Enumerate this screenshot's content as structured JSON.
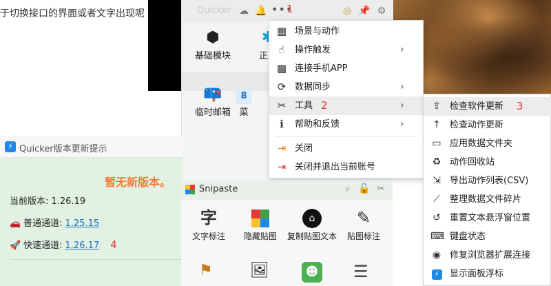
{
  "article": {
    "text": "于切换接口的界面或者文字出现呢"
  },
  "quicker": {
    "title": "Quicker",
    "more_marker": "1",
    "tiles": [
      {
        "icon": "cubes-icon",
        "label": "基础模块"
      },
      {
        "icon": "regex-icon",
        "label": "正则"
      },
      {
        "icon": "mailbox-icon",
        "label": "临时邮箱"
      },
      {
        "icon": "menu-8-icon",
        "label": "菜"
      }
    ],
    "menu": [
      {
        "icon": "grid-icon",
        "label": "场景与动作",
        "submenu": false
      },
      {
        "icon": "hand-pointer-icon",
        "label": "操作触发",
        "submenu": true
      },
      {
        "icon": "qrcode-icon",
        "label": "连接手机APP",
        "submenu": false
      },
      {
        "icon": "sync-icon",
        "label": "数据同步",
        "submenu": true
      },
      {
        "icon": "tools-icon",
        "label": "工具",
        "submenu": true,
        "marker": "2"
      },
      {
        "icon": "help-icon",
        "label": "帮助和反馈",
        "submenu": true
      },
      {
        "icon": "close-arrow-icon",
        "label": "关闭",
        "submenu": false
      },
      {
        "icon": "logout-icon",
        "label": "关闭并退出当前账号",
        "submenu": false
      }
    ],
    "submenu": [
      {
        "icon": "upload-icon",
        "label": "检查软件更新",
        "marker": "3"
      },
      {
        "icon": "arrow-up-icon",
        "label": "检查动作更新"
      },
      {
        "icon": "folder-icon",
        "label": "应用数据文件夹"
      },
      {
        "icon": "recycle-icon",
        "label": "动作回收站"
      },
      {
        "icon": "export-icon",
        "label": "导出动作列表(CSV)"
      },
      {
        "icon": "broom-icon",
        "label": "整理数据文件碎片"
      },
      {
        "icon": "reset-icon",
        "label": "重置文本悬浮窗位置"
      },
      {
        "icon": "keyboard-icon",
        "label": "键盘状态"
      },
      {
        "icon": "chrome-icon",
        "label": "修复浏览器扩展连接"
      },
      {
        "icon": "quicker-icon",
        "label": "显示面板浮标"
      }
    ]
  },
  "update_window": {
    "title": "Quicker版本更新提示",
    "status": "暂无新版本。",
    "current_label": "当前版本: 1.26.19",
    "normal_label": "普通通道:",
    "normal_version": "1.25.15",
    "fast_label": "快速通道:",
    "fast_version": "1.26.17",
    "fast_marker": "4"
  },
  "snipaste": {
    "title": "Snipaste",
    "tiles": [
      {
        "icon": "text-char-icon",
        "glyph": "字",
        "label": "文字标注"
      },
      {
        "icon": "windows-logo-icon",
        "label": "隐藏贴图"
      },
      {
        "icon": "copy-pin-text-icon",
        "label": "复制贴图文本"
      },
      {
        "icon": "pen-annotate-icon",
        "label": "贴图标注"
      }
    ]
  },
  "colors": {
    "accent_orange": "#f47a3a",
    "marker_red": "#e53935",
    "link_blue": "#1e6fc2",
    "update_bg": "#e2f2e2"
  }
}
